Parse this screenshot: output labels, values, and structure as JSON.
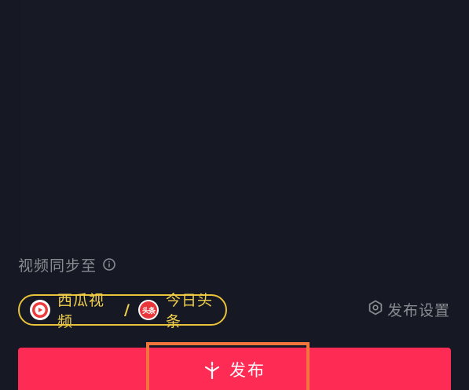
{
  "sync": {
    "label": "视频同步至"
  },
  "platforms": {
    "first": "西瓜视频",
    "separator": "/",
    "second": "今日头条",
    "second_icon_text": "头条",
    "accent_color": "#f0d04e"
  },
  "settings": {
    "label": "发布设置"
  },
  "publish": {
    "label": "发布",
    "color": "#fe2c55"
  },
  "highlight": {
    "color": "#f2763c"
  },
  "icons": {
    "info": "info-icon",
    "xigua": "xigua-video-icon",
    "toutiao": "toutiao-icon",
    "settings": "hexagon-settings-icon",
    "publish": "sparkle-icon"
  }
}
